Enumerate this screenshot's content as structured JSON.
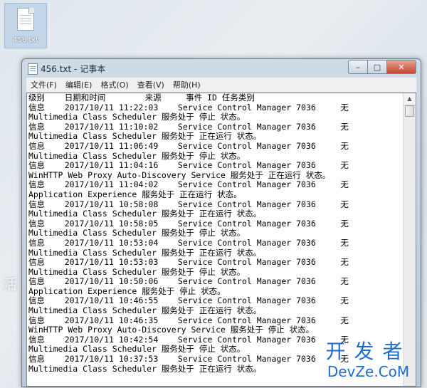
{
  "desktop": {
    "icon_label": "456.txt",
    "side_text": "活"
  },
  "window": {
    "title": "456.txt - 记事本",
    "buttons": {
      "minimize": "–",
      "maximize": "□",
      "close": "✕"
    }
  },
  "menu": [
    {
      "label": "文件(F)"
    },
    {
      "label": "编辑(E)"
    },
    {
      "label": "格式(O)"
    },
    {
      "label": "查看(V)"
    },
    {
      "label": "帮助(H)"
    }
  ],
  "document": {
    "lines": [
      "级别    日期和时间        来源     事件 ID 任务类别",
      "信息    2017/10/11 11:22:03    Service Control Manager 7036     无",
      "Multimedia Class Scheduler 服务处于 停止 状态。",
      "信息    2017/10/11 11:10:02    Service Control Manager 7036     无",
      "Multimedia Class Scheduler 服务处于 正在运行 状态。",
      "信息    2017/10/11 11:06:49    Service Control Manager 7036     无",
      "Multimedia Class Scheduler 服务处于 停止 状态。",
      "信息    2017/10/11 11:04:16    Service Control Manager 7036     无",
      "WinHTTP Web Proxy Auto-Discovery Service 服务处于 正在运行 状态。",
      "信息    2017/10/11 11:04:02    Service Control Manager 7036     无",
      "Application Experience 服务处于 正在运行 状态。",
      "信息    2017/10/11 10:58:08    Service Control Manager 7036     无",
      "Multimedia Class Scheduler 服务处于 正在运行 状态。",
      "信息    2017/10/11 10:58:05    Service Control Manager 7036     无",
      "Multimedia Class Scheduler 服务处于 停止 状态。",
      "信息    2017/10/11 10:53:04    Service Control Manager 7036     无",
      "Multimedia Class Scheduler 服务处于 正在运行 状态。",
      "信息    2017/10/11 10:53:03    Service Control Manager 7036     无",
      "Multimedia Class Scheduler 服务处于 停止 状态。",
      "信息    2017/10/11 10:50:06    Service Control Manager 7036     无",
      "Application Experience 服务处于 停止 状态。",
      "信息    2017/10/11 10:46:55    Service Control Manager 7036     无",
      "Multimedia Class Scheduler 服务处于 正在运行 状态。",
      "信息    2017/10/11 10:46:35    Service Control Manager 7036     无",
      "WinHTTP Web Proxy Auto-Discovery Service 服务处于 停止 状态。",
      "信息    2017/10/11 10:42:54    Service Control Manager 7036     无",
      "Multimedia Class Scheduler 服务处于 停止 状态。",
      "信息    2017/10/11 10:37:53    Service Control Manager 7036     无",
      "Multimedia Class Scheduler 服务处于 正在运行 状态。"
    ]
  },
  "watermark": {
    "top": "开发者",
    "bottom": "DevZe.CoM"
  },
  "colors": {
    "watermark": "#1e6cd0",
    "close_button": "#c9452e"
  }
}
